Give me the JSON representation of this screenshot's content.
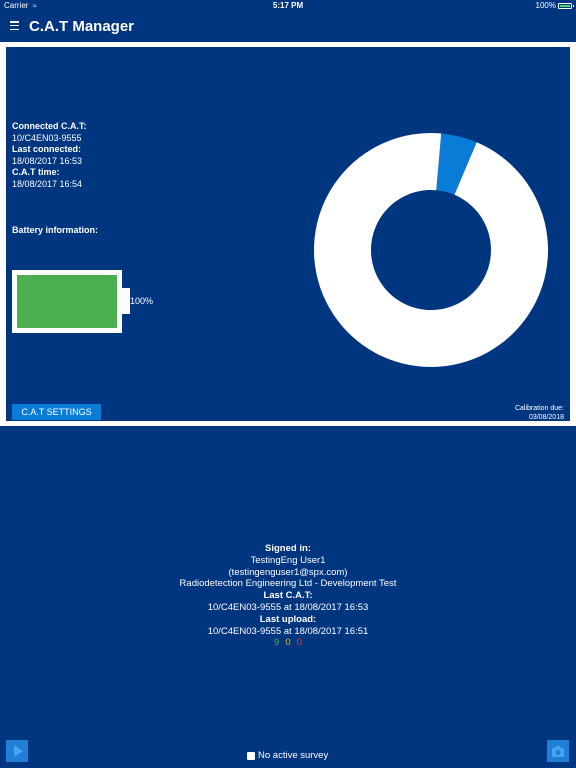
{
  "status_bar": {
    "carrier": "Carrier",
    "time": "5:17 PM",
    "battery": "100%"
  },
  "nav": {
    "title": "C.A.T Manager"
  },
  "device": {
    "connected_label": "Connected C.A.T:",
    "connected_value": "10/C4EN03-9555",
    "last_connected_label": "Last connected:",
    "last_connected_value": "18/08/2017 16:53",
    "cat_time_label": "C.A.T time:",
    "cat_time_value": "18/08/2017 16:54",
    "battery_label": "Battery information:",
    "battery_percent": "100%",
    "battery_level": 1.0
  },
  "chart_data": {
    "type": "pie",
    "style": "donut",
    "title": "",
    "series": [
      {
        "label": "",
        "fraction": 0.05,
        "color": "#0a7bd6"
      },
      {
        "label": "",
        "fraction": 0.95,
        "color": "#ffffff"
      }
    ]
  },
  "actions": {
    "cat_settings_label": "C.A.T SETTINGS"
  },
  "calibration": {
    "label": "Calibration due:",
    "date": "03/08/2018"
  },
  "summary": {
    "signed_in_label": "Signed in:",
    "user_name": "TestingEng User1",
    "user_email": "(testingenguser1@spx.com)",
    "organisation": "Radiodetection Engineering Ltd - Development Test",
    "last_cat_label": "Last C.A.T:",
    "last_cat_value": "10/C4EN03-9555 at 18/08/2017 16:53",
    "last_upload_label": "Last upload:",
    "last_upload_value": "10/C4EN03-9555 at 18/08/2017 16:51",
    "count_green": "9",
    "count_yellow": "0",
    "count_red": "0"
  },
  "footer": {
    "survey_label": "No active survey"
  },
  "icons": {
    "menu": "menu-icon",
    "play": "play-icon",
    "camera": "camera-icon",
    "wifi": "wifi-icon",
    "battery": "battery-icon"
  }
}
